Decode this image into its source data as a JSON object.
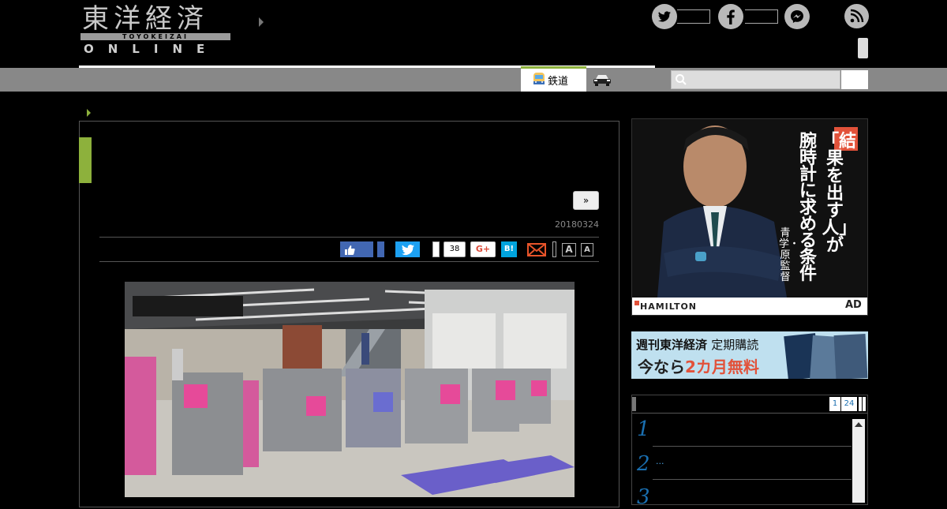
{
  "header": {
    "logo_main": "東洋経済",
    "logo_bar": "TOYOKEIZAI",
    "logo_sub": "ONLINE"
  },
  "nav": {
    "tabs": [
      {
        "label": "鉄道",
        "icon": "train-icon",
        "active": true
      },
      {
        "label": "",
        "icon": "car-icon",
        "active": false
      }
    ],
    "search": {
      "placeholder": ""
    }
  },
  "article": {
    "next_label": "»",
    "date": "20180324",
    "share": {
      "hatena_count": "38",
      "gplus_label": "G+",
      "hatena_label": "B!",
      "font_large": "A",
      "font_small": "A"
    }
  },
  "sidebar": {
    "ad_hamilton": {
      "headline_col1": "「結果を出す人」が",
      "headline_col2": "腕時計に求める条件",
      "byline": "青学・原監督",
      "brand": "HAMILTON",
      "ad_label": "AD"
    },
    "ad_subscription": {
      "magazine": "週刊東洋経済",
      "title": "定期購読",
      "offer_prefix": "今なら",
      "offer_highlight": "2カ月無料"
    },
    "ranking": {
      "pages": [
        "1",
        "24"
      ],
      "items": [
        {
          "rank": "1",
          "text": ""
        },
        {
          "rank": "2",
          "text": "..."
        },
        {
          "rank": "3",
          "text": ""
        }
      ]
    }
  },
  "colors": {
    "accent_green": "#8db13c",
    "facebook": "#4267b2",
    "twitter": "#1da1f2",
    "hatena": "#00a4de"
  }
}
